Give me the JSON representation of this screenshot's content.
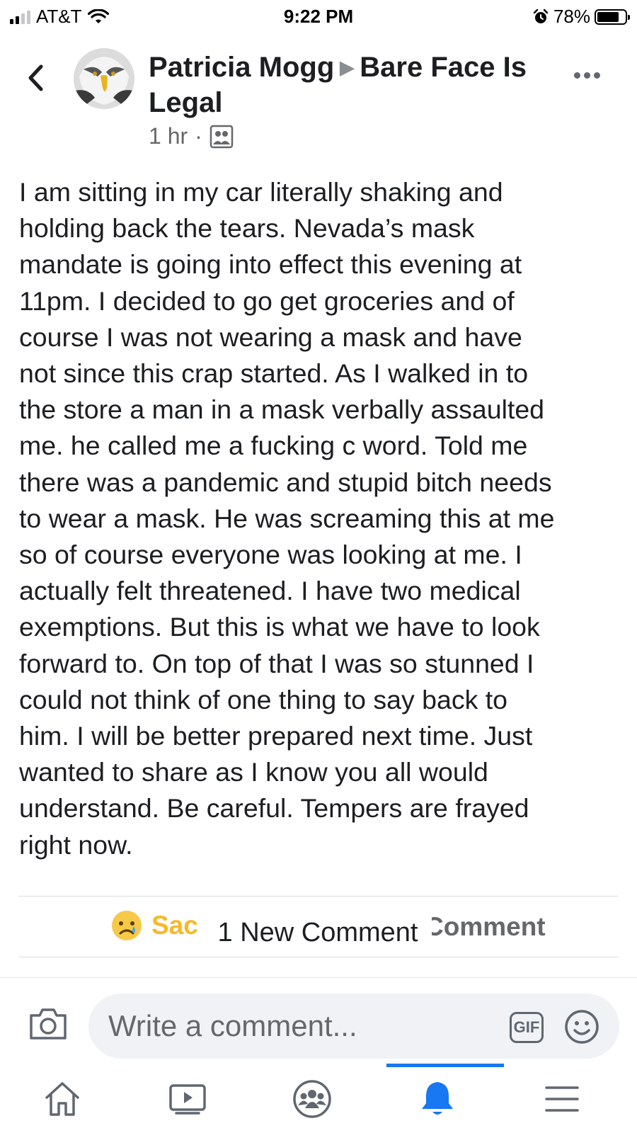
{
  "status_bar": {
    "carrier": "AT&T",
    "time": "9:22 PM",
    "battery_percent": "78%",
    "battery_level": 0.78,
    "signal_bars_filled": 2,
    "signal_bars_total": 4
  },
  "post": {
    "author": "Patricia Mogg",
    "group": "Bare Face Is Legal",
    "timestamp": "1 hr",
    "separator": "·",
    "audience_icon": "group-members-icon",
    "avatar_icon": "bald-eagle-avatar",
    "body": "I am sitting in my car literally shaking and\nholding back the tears. Nevada’s mask\nmandate is going into effect this evening at\n11pm. I decided to go get groceries and of\ncourse I was not wearing a mask and have\nnot since this crap started. As I walked in to\nthe store a man in a mask verbally assaulted\nme. he called me a fucking c word. Told me\nthere was a pandemic and stupid bitch needs\nto wear a mask. He was screaming this at me\nso of course everyone was looking at me.  I\nactually felt threatened. I have two medical\nexemptions. But this is what we have to look\nforward to.  On top of that I was so stunned I\ncould not think of one thing to say back to\nhim. I will be better prepared next time.  Just\nwanted to share as I know you all would\nunderstand. Be careful. Tempers are frayed\nright now."
  },
  "actions": {
    "reaction_label": "Sad",
    "reaction_label_visible": "Sac",
    "comment_label_visible": "Comment",
    "new_comment_pill": "1 New Comment"
  },
  "composer": {
    "placeholder": "Write a comment...",
    "gif_label": "GIF"
  },
  "tabbar": {
    "items": [
      "home-icon",
      "watch-icon",
      "groups-icon",
      "notifications-icon",
      "menu-icon"
    ],
    "active": "notifications-icon"
  },
  "colors": {
    "accent": "#1877f2",
    "sad_reaction": "#f7b928",
    "secondary_text": "#65676b",
    "primary_text": "#1c1e21"
  }
}
